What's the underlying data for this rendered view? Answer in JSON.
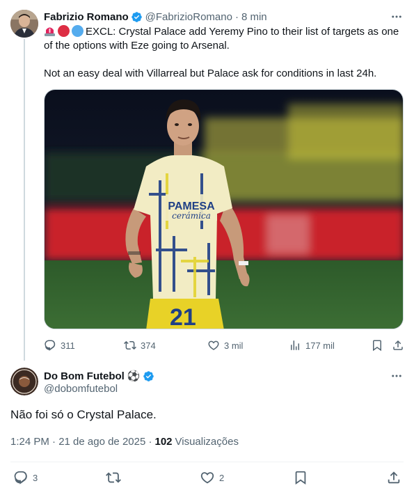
{
  "tweet": {
    "author_name": "Fabrizio Romano",
    "author_handle": "@FabrizioRomano",
    "separator": "·",
    "time": "8 min",
    "text_line1": "EXCL: Crystal Palace add Yeremy Pino to their list of targets as one of the options with Eze going to Arsenal.",
    "text_line2": "Not an easy deal with Villarreal but Palace ask for conditions in last 24h.",
    "emojis": [
      "siren-emoji",
      "red-circle-emoji",
      "blue-circle-emoji"
    ],
    "media": {
      "shirt_sponsor": "PAMESA",
      "shirt_sponsor_sub": "cerámica",
      "shirt_number": "21"
    },
    "actions": {
      "replies": "311",
      "reposts": "374",
      "likes": "3 mil",
      "views": "177 mil"
    }
  },
  "reply": {
    "author_name": "Do Bom Futebol",
    "author_emoji": "⚽",
    "author_handle": "@dobomfutebol",
    "avatar_text": "DO BOM FUTEBOL",
    "text": "Não foi só o Crystal Palace.",
    "timestamp": "1:24 PM · 21 de ago de 2025 ·",
    "views_count": "102",
    "views_label": "Visualizações",
    "actions": {
      "replies": "3",
      "likes": "2"
    }
  },
  "colors": {
    "verified_blue": "#1d9bf0",
    "muted_text": "#536471",
    "text": "#0f1419",
    "border": "#cfd9de"
  }
}
